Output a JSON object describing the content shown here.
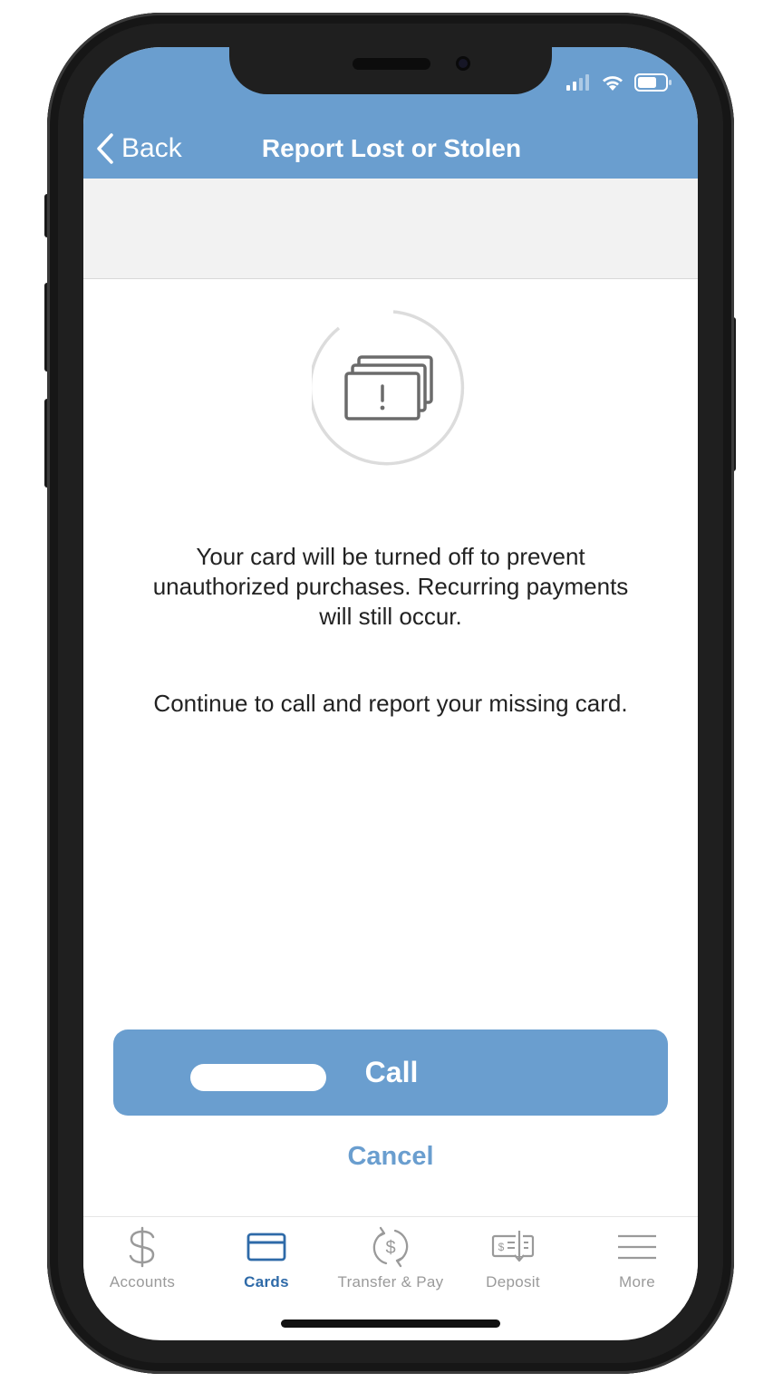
{
  "colors": {
    "accent": "#6a9ecf",
    "active_tab": "#2e6aa8",
    "inactive_tab": "#9a9a9a"
  },
  "status_bar": {
    "icons": [
      "cellular-signal-icon",
      "wifi-icon",
      "battery-icon"
    ]
  },
  "header": {
    "back_label": "Back",
    "title": "Report Lost or Stolen"
  },
  "main": {
    "icon": "cards-alert-icon",
    "message_1": "Your card will be turned off to prevent unauthorized purchases. Recurring payments will still occur.",
    "message_2": "Continue to call and report your missing card.",
    "call_label": "Call",
    "cancel_label": "Cancel"
  },
  "tabbar": {
    "items": [
      {
        "label": "Accounts",
        "icon": "dollar-sign-icon",
        "active": false
      },
      {
        "label": "Cards",
        "icon": "credit-card-icon",
        "active": true
      },
      {
        "label": "Transfer & Pay",
        "icon": "transfer-dollar-icon",
        "active": false
      },
      {
        "label": "Deposit",
        "icon": "check-deposit-icon",
        "active": false
      },
      {
        "label": "More",
        "icon": "hamburger-menu-icon",
        "active": false
      }
    ]
  }
}
